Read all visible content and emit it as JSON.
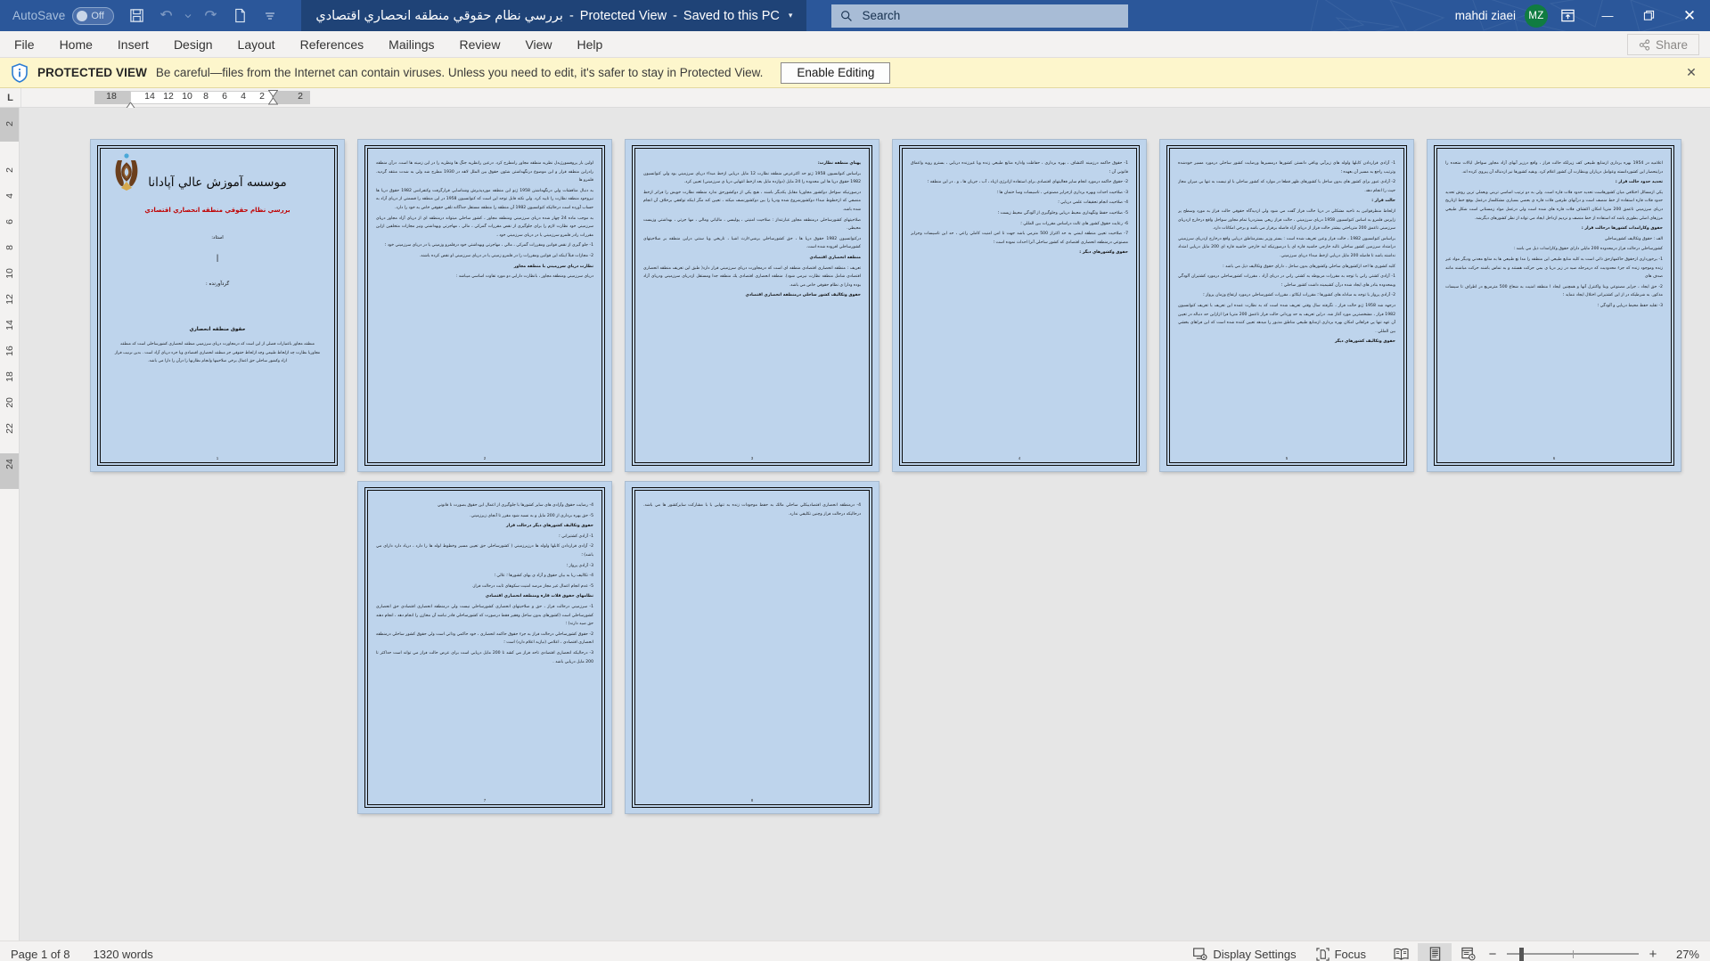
{
  "titlebar": {
    "autosave_label": "AutoSave",
    "autosave_state": "Off",
    "icons": [
      "save-icon",
      "undo-icon",
      "undo-dropdown-icon",
      "redo-icon",
      "print-preview-icon",
      "customize-qat-icon"
    ],
    "document_name": "بررسي نظام حقوقي منطقه انحصاري اقتصادي",
    "protected_view_tag": "Protected View",
    "save_state": "Saved to this PC",
    "dropdown_caret": "▾",
    "search_placeholder": "Search",
    "user_name": "mahdi ziaei",
    "user_initials": "MZ",
    "ribbon_display_icon": "ribbon-display-options-icon",
    "minimize": "—",
    "restore": "❐",
    "close": "✕"
  },
  "ribbon": {
    "tabs": [
      "File",
      "Home",
      "Insert",
      "Design",
      "Layout",
      "References",
      "Mailings",
      "Review",
      "View",
      "Help"
    ],
    "share_label": "Share",
    "share_icon": "share-icon"
  },
  "protected_view": {
    "icon": "shield-info-icon",
    "title": "PROTECTED VIEW",
    "message": "Be careful—files from the Internet can contain viruses. Unless you need to edit, it's safer to stay in Protected View.",
    "button_label": "Enable Editing",
    "close_icon": "✕"
  },
  "ruler": {
    "tabstop_label": "L",
    "horizontal_numbers": [
      "18",
      "14",
      "12",
      "10",
      "8",
      "6",
      "4",
      "2",
      "2"
    ],
    "vertical_numbers": [
      "2",
      "2",
      "4",
      "6",
      "8",
      "10",
      "12",
      "14",
      "16",
      "18",
      "20",
      "22",
      "24"
    ]
  },
  "statusbar": {
    "page_label": "Page 1 of 8",
    "word_count": "1320 words",
    "display_settings": "Display Settings",
    "display_settings_icon": "display-settings-icon",
    "focus": "Focus",
    "focus_icon": "focus-icon",
    "view_read_icon": "read-mode-icon",
    "view_print_icon": "print-layout-icon",
    "view_web_icon": "web-layout-icon",
    "zoom_out": "−",
    "zoom_in": "+",
    "zoom_level": "27%"
  },
  "document": {
    "pages": [
      {
        "type": "cover",
        "title": "موسسه آموزش عالي آپادانا",
        "subject": "بررسي نظام حقوقي منطقه انحصاري اقتصادي",
        "teacher_label": "استاد:",
        "cursor": "|",
        "author_label": "گردآورنده :",
        "section_title": "حقوق منطقه انحصاري",
        "paragraph": "منطقه مجاور باعتبارات فصلي از اين است كه درمجاورت درياي سرزميني منطقه انحصاري كشورساحلي است كه منطقه مجاوربا نظارت چه ازلحاظ طبيعي وچه ازلحاظ حقوقي جز منطقه انحصاري اقتصادي وبا جزء درياي آزاد است . بدين ترتيب فراز ازاد وكشور ساحلي حق اعمال برخي صلاحيتها وانجام نظارتها را درآن را دارا مي باشد.",
        "logo_icon": "apadana-institute-logo",
        "page_number": "1"
      },
      {
        "type": "text",
        "page_number": "2",
        "paragraphs": [
          "اولين بار پروفسورژيدل نظريه منطقه مجاور رامطرح كرد. درعين رانظريه جنگ ها ونظريه را در اين زمينه ها است. درآن منطقه رادراين منطقه قرار و اين موضوع درنگهداشتن شئون حقوق بين الملل لاهه در 1930 مطرح شد ولي به شدت منتقد گرديد. قلمرو ها",
          "به دنبال مناقشات ولي درنگهداشتن 1958 ژنو اين منطقه موردپذيرش وشناسايي قرارگرفت وكنفرانس 1982 حقوق دريا ها نيزوجود منطقه نظارت را تاييد كرد. ولي نكته قابل توجه اين است كه كنوانسيون 1958 در اين منطقه را قسمتي از درياي آزاد به حساب آورده است درحاليكه كنوانسيون 1982 آن منطقه را منطقه مستقل جداگانه تلقي حقوقي خاص به خود را دارد.",
          "به موجب ماده 24 چهار شده درياي سرزميني ومنطقه مجاور ، كشور ساحلي ميتواند درمنطقه اي از درياي آزاد مجاور درياي سرزميني خود نظارت لازم را براي جلوگيري از نقض مقررات گمركي ، مالي ، مهاجرتي وبهداشتي ونيز مجازات متخلفين ازاين مقررات رادر قلمرو سرزميني يا در درياي سرزميني خود ،",
          "1- جلو گيري از نقض قوانين ومقررات گمركي ، مالي ، مهاجرتي وبهداشتي خود درقلمرو وزميني يا در درياي سرزميني خود ؛",
          "2- مجازات قبلاً اينكه اين قوانين ومقررات را در قلمرو زميني يا در درياي سرزميني او نقض كرده باشند.",
          "نظارت درياي سرزميني با منطقه مجاور",
          "درياي سرزميني ومنطقه مجاور ، بانظارت دارابي دو مورد تفاوت اساسي ميباشد :"
        ]
      },
      {
        "type": "text",
        "page_number": "3",
        "paragraphs": [
          "پهناي منطقه نظارت:",
          "براساس كنوانسيون 1958 ژنو حد اكثرعرض منطقه نظارت 12 مايل دريايي ازخط مبداء درياي سرزميني بود ولي كنوانسيون 1982 حقوق دريا ها اين محدوده را 24 مايل (دوازده مايل بعد ازخط انتهايي دريا ي سرزميني) تعيين كرد.",
          "درصورتيكه سواحل دوكشور مجاوريا مقابل يكديگر باشند ، هيچ يكي از دوكشورحق ندارد منطقه نظارت خويش را فراتر ازخط منصفي كه ازخطوط مبداء دوكشورشروع شده ودريا را بين دوكشورنصف ميكند ، تعيين كند مگر اينكه توافقي برخلاف آن انجام شده باشد.",
          "صلاحيتهاي كشورساحلي درمنطقه مجاور عبارتنداز : صلاحيت امنيتي ، پوليسي ، مالياتي ومالي ، مها جرتي ، بهداشتي وزيست محيطي.",
          "دركنوانسيون 1982 حقوق دريا ها ، حق كشورساحلي برشيءارث اشيا ، تاريخي وبا سنتي دراين منطقه بر صلاحيتهاي كشورساحلي افزوده شده است.",
          "منطقه انحصاري اقتصادي",
          "تعريف : منطقه انحصاري اقتصادي منطقه اي است كه درمجاورت درياي سرزميني قرار دارد( طبق اين تعريف منطقه انحصاري اقتصادي شامل منطقه نظارت نيزمي شود). منطقه انحصاري اقتصادي يك منطقه جدا ومستقل ازدرياي سرزميني ودرياي آزاد بوده ودارا ي نظام حقوقي خاص مي باشد.",
          "حقوق وتكاليف كشور ساحلي درمنطقه انحصاري اقتصادي"
        ]
      },
      {
        "type": "text",
        "page_number": "4",
        "paragraphs": [
          "1- حقوق حاكمه درزمينه اكتشاف ، بهره برداري ، حفاظت واداره منابع طبيعي زنده ويا غيرزنده دريايي ، بسترو رويه واعماق قانوني آن ؛",
          "2- حقوق حاكمه درمورد انجام ساير فعاليتهاي اقتصادي براي استفاده ازانرژي ازباد ، آب ، جريان ها ، و . در اين منطقه ؛",
          "3- صلاحيت احداث وبهره برداري ازجزاير مصنوعي ، تاسيسات وسا ختمان ها ؛",
          "4- صلاحيت انجام تحقيقات علمي دريايي ؛",
          "5- صلاحيت حفظ ونگهداري محيط دريايي وجلوگيري از آلودگي محيط زيست ؛",
          "6- رعايت حقوق كشور هاي ثالث دراساس مقررات بين المللي ؛",
          "7- صلاحيت تعيين منطقه ايمني به حد اكثراز 500 مترمي باشد جهت تا امن امنيت كاملي راعي ، حد اين تاسيسات وجزاير مصنوعي درمنطقه انحصاري اقتصادي كه كشور ساحلي آنرا احداث نموده است ؛",
          "حقوق وكشورهاي ديگر :"
        ]
      },
      {
        "type": "text",
        "page_number": "5",
        "paragraphs": [
          "1- آزادي قراردادن كابلها ولوله هاي زيرآبي وباقي دانستن كشورها درمسيرها ورضايت كشور ساحلي درمورد مسير خودشده وترتيب راجع به مسير آن بعهده ؛",
          "2- آزادي عبور براي كشور هاي بدون ساحل با كشورهاي ظهر قطعا در موارد كه كشور ساحلي با او نيست به تنها بي ميزان مجاز حيث را انجام دهد.",
          "حالت فراز :",
          "ازلحاظ منظرقوانين به ناحيه مشكلي در دريا حالت فراز گفت مي شود ولي ازديدگاه حقوقي حالت فراز به مورد وسطح پر زاپرس قلمرو به اساس كنوانسيون 1958 درياي سرزميني ، حالت فراز ريعي بستردريا تمام مجاور سواحل واقع درخارج ازدرياي سرزميني تاعمق 200 مترياحتي بيشتر حالت فراز از درياي آزاد فاصله برقرار مي باشد و برخي امكانات دارد.",
          "براساس كنوانسيون 1982 ، حالت فراز وعين تعريف شده است : بستر وزير بسترمناطق دريايي واقع درخارج ازدرياي سرزميني درامتداد سرزمين كشور ساحلي تالبه خارجي حاشيه قاره اي يا درصورتيكه لبه خارجي حاشيه قاره اي 200 مايل دريايي امتداد نداشته باشد تا فاصله 200 مايل دريايي ازخط مبداء درياي سرزميني.",
          "كلبه كشوري ها احد ازكشورهاي ساحلي وكشورهاي بدون ساحل ، داراي حقوق وتكاليف ذيل مي باشد :",
          "1- آزادي كشتي راني با توجه به مقررات مربوطه به كشتي راني در درياي آزاد ، مقررات كشورساحلي درمورد كشتيران آلودگي وبمحدوده بنادر هاي ايجاد شده درآن كشيمينه داشت كشور ساحلي ؛",
          "2- آزادي پرواز با توجه به مبادله هاي كشورها ؛ مقررات ايكائو ، مقررات كشورساحلي درمورد ارتفاع وزمان پرواز ؛",
          "درجهه شد 1958 ژنو حالت فراز ، نگرفته سال وقتي تعريف شده است كه به نظارت عمده اين تعريف با تعريف كنوانسيون 1982 فراز ، مشخصترين مورد آغاز شد. دراين تعريف به حد ورداني حالت فراز تاعمق 200 متريا فرا ازازاين حد دنباله در تعيين آن عهد تنها پي فراهاني امكان بهره برداري ازمنابع طبيعي مناطق مذبور را ميدهد تعيين كننده شده است كه اين فراهاي بخشي بين المللي .",
          "حقوق وتكاليف كشورهاي ديگر"
        ]
      },
      {
        "type": "text",
        "page_number": "6",
        "paragraphs": [
          "اعلاميه در 1954 بهره برداري ازمنابع طبيعي كف زيرلكه حالت فراز ، واقع درزير آبهاي آزاد مجاور سواحل ايالات متحده را دراينحصار اين كشوردانسته وعوامل درياران وبنظارت آن كشور اعلام كرد. وبقيه كشورها نيز ازدنباله آن پيروي كرده اند.",
          "تحديد حدود حالت فراز :",
          "يكي ازمسائل اختلافي ميان كشورهاست تحديد حدود فلات قاره است. ولي به دو ترتيب اساسي تريني وبعملي ترين روش تحديد حدود فلات قاره استفاده از خط منصف است و درآنهاي طرفين فلات قاره ي بعضي بسياري مشكلساز درعمل بوقع خط ازتاريخ درياي سرزميني تاعمق 200 متريا امكان اكتشاف فلات قاره هاي شده است ولي درعمل مواد زمستاني است شكل طبيعي مرزهاي اصلي بطوري باشد كه استفاده از خط منصف و نزديم ازداخل ايجاد مي تواند از نظر كشورهاي ديگرشد.",
          "حقوق وكارامدات كشورها درحالت فراز :",
          "الف : حقوق وتكاليف كشورساحلي",
          "كشورساحلي درحالت فراز درمحدوده 200 مايلي داراي حقوق وكارامدات ذيل مي باشد :",
          "1- برخورداري ازحقوق حاكمهازحق ذاتي است به كليه منابع طبيعي اين منطقه را مدا نع طبيعي ها به منابع معدني وديگر مواد غير زنده وموجود زنده كه جزء محدوديت كه درمرحله صيد در زير دريا ي بمي حركت هستند و به تماس باشند حركت مباشند مانند صدف هاي",
          "2- حق ايجاد ، جزاير مصنوعي وبنا واكنترل آنها و همچنين ايجاد ا منطقه امنيت به شعاع 500 مترمربع در اطراف تا سيسات مذكور. به شرطيكه در از اين كشتيراني اختلال ايجاد ننمايد ؛",
          "3- تقليد حفظ محيط دريايي و آلودگي ؛"
        ]
      },
      {
        "type": "text",
        "page_number": "7",
        "paragraphs": [
          "4- رضايت حقوق وآزادي هاي ساير كشورها با جلوگيري از اعمال اين حقوق بصورت نا قانوني",
          "5- حق بهره برداري از 200 مايل و به نسبه شود مقرر تا آنجاي زيرزميني.",
          "حقوق وتكاليف كشورهاي ديگر درحالت فراز",
          "1- آزادي كشتيراني ؛",
          "2- آزادي قراردادن كابلها ولوله ها درزيرزميني ( كشورساحلي حق تعيين مسير وخطوط لوله ها را دارد ، درياد دارد داراي مي باشد) ؛",
          "3- آزادي پرواز ؛",
          "4- تكاليف ربا به بيان حقوق و آزاد ي بهاي كشورها ؛ عالي ؛",
          "5- عدم انجام اعمال غير مجاز مرصد امنيت سكوهاي ثابت درحالت فراز.",
          "نظامهاي حقوق فلات قاره ومنطقه انحصاري اقتصادي",
          "1- سرزميني درحالت فراز ، حق و صلاحيتهاي انحصاري كشورساحلي نيست ولي درمنطقه انحصاري اقتصادي حق انحصاري كشورساحلي است (كشورهاي بدون ساحل وفقير فقط درصورت كه كشورساحلي قادر نباشد آن مخازن را انجام دهد ، انجام دهند حق صيد دارند) ؛",
          "2- حقوق كشورساحلي درحالت فراز به جزء حقوق حاكمه انحصاري ، خود حاكمي وذاتي است ولي حقوق كشور ساحلي درمنطقه انحصاري اقتصادي ، اعلامي (نيازبه اعلام دارد) است ؛",
          "3- درحاليكه انحصاري اقتصادي تاحد فراز مي كشد تا 200 مايل دريايي است براي عرض حالت فراز مي تواند است حداكثر تا 200 مايل دريايي باشد ."
        ]
      },
      {
        "type": "text",
        "page_number": "8",
        "paragraphs": [
          "4- درمنطقه انحصاري اقتصاديبكلي ساحلي مالك به حفظ موجودات زنده به تنهايي با با مشاركت سايركشور ها مي باشد. درحاليكه درحالت فراز وچنين تكليفي ندارد."
        ]
      }
    ]
  }
}
